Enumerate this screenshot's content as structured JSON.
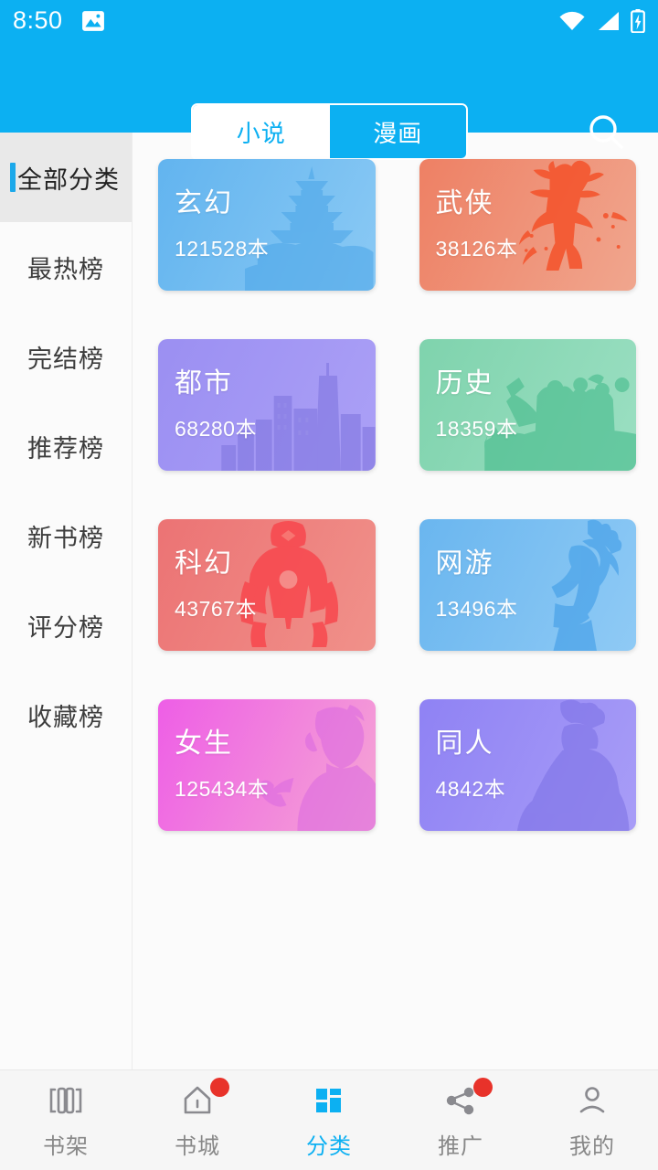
{
  "status_bar": {
    "time": "8:50",
    "icons": [
      "photo-icon",
      "wifi-icon",
      "signal-icon",
      "battery-charging-icon"
    ]
  },
  "app_bar": {
    "segments": [
      {
        "label": "小说",
        "active": true
      },
      {
        "label": "漫画",
        "active": false
      }
    ],
    "search_icon": "search-icon",
    "background_color": "#0cb0f2"
  },
  "sidebar": {
    "items": [
      {
        "label": "全部分类",
        "active": true
      },
      {
        "label": "最热榜",
        "active": false
      },
      {
        "label": "完结榜",
        "active": false
      },
      {
        "label": "推荐榜",
        "active": false
      },
      {
        "label": "新书榜",
        "active": false
      },
      {
        "label": "评分榜",
        "active": false
      },
      {
        "label": "收藏榜",
        "active": false
      }
    ],
    "active_indicator_color": "#1ca9ea"
  },
  "categories": [
    {
      "title": "玄幻",
      "count": "121528本",
      "art": "pagoda-silhouette",
      "color_from": "#62b4ef",
      "color_to": "#86c7f3",
      "art_color": "#4aa5e8"
    },
    {
      "title": "武侠",
      "count": "38126本",
      "art": "warrior-silhouette",
      "color_from": "#ef8666",
      "color_to": "#f0a187",
      "art_color": "#f4522a"
    },
    {
      "title": "都市",
      "count": "68280本",
      "art": "city-skyline-silhouette",
      "color_from": "#9e92f3",
      "color_to": "#a79cf5",
      "art_color": "#8076e0"
    },
    {
      "title": "历史",
      "count": "18359本",
      "art": "soldiers-cannon-silhouette",
      "color_from": "#7fd3ad",
      "color_to": "#96dcbd",
      "art_color": "#4bbd8f"
    },
    {
      "title": "科幻",
      "count": "43767本",
      "art": "robot-silhouette",
      "color_from": "#ec7374",
      "color_to": "#ef8c84",
      "art_color": "#f8434a"
    },
    {
      "title": "网游",
      "count": "13496本",
      "art": "gamer-silhouette",
      "color_from": "#6ab6ef",
      "color_to": "#8ac8f4",
      "art_color": "#3f9ce6"
    },
    {
      "title": "女生",
      "count": "125434本",
      "art": "girl-flower-silhouette",
      "color_from": "#ef5fe6",
      "color_to": "#f3a0d6",
      "art_color": "#d968e0"
    },
    {
      "title": "同人",
      "count": "4842本",
      "art": "dress-figure-silhouette",
      "color_from": "#8f82f4",
      "color_to": "#a79cf7",
      "art_color": "#7b6fe4"
    }
  ],
  "bottom_nav": {
    "items": [
      {
        "label": "书架",
        "icon": "bookshelf-icon",
        "active": false,
        "badge": false
      },
      {
        "label": "书城",
        "icon": "home-icon",
        "active": false,
        "badge": true
      },
      {
        "label": "分类",
        "icon": "grid-icon",
        "active": true,
        "badge": false
      },
      {
        "label": "推广",
        "icon": "share-icon",
        "active": false,
        "badge": true
      },
      {
        "label": "我的",
        "icon": "person-icon",
        "active": false,
        "badge": false
      }
    ],
    "active_color": "#0cb0f2",
    "badge_color": "#e8322a"
  }
}
